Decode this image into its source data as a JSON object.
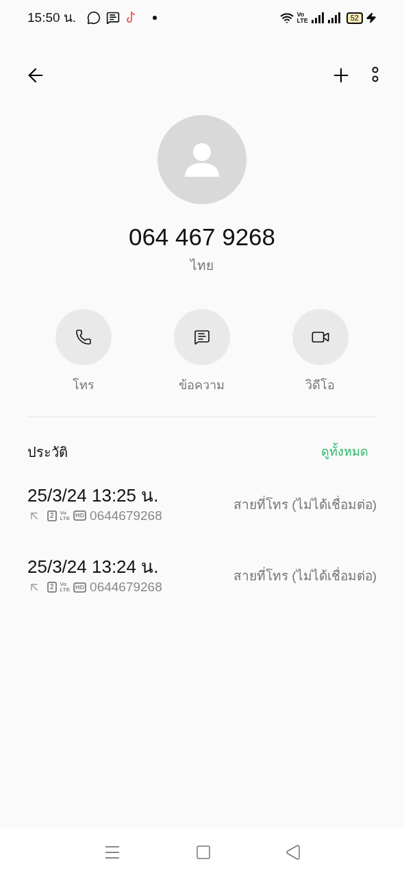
{
  "status_bar": {
    "time": "15:50 น.",
    "volte_top": "Vo",
    "volte_bottom": "LTE",
    "battery": "52"
  },
  "contact": {
    "number": "064 467 9268",
    "location": "ไทย"
  },
  "actions": [
    {
      "kind": "call",
      "label": "โทร"
    },
    {
      "kind": "message",
      "label": "ข้อความ"
    },
    {
      "kind": "video",
      "label": "วิดีโอ"
    }
  ],
  "history": {
    "title": "ประวัติ",
    "view_all": "ดูทั้งหมด",
    "entries": [
      {
        "datetime": "25/3/24 13:25 น.",
        "sim": "2",
        "vo": "Vo",
        "lte": "LTE",
        "hd": "HD",
        "number": "0644679268",
        "status": "สายที่โทร (ไม่ได้เชื่อมต่อ)"
      },
      {
        "datetime": "25/3/24 13:24 น.",
        "sim": "2",
        "vo": "Vo",
        "lte": "LTE",
        "hd": "HD",
        "number": "0644679268",
        "status": "สายที่โทร (ไม่ได้เชื่อมต่อ)"
      }
    ]
  }
}
